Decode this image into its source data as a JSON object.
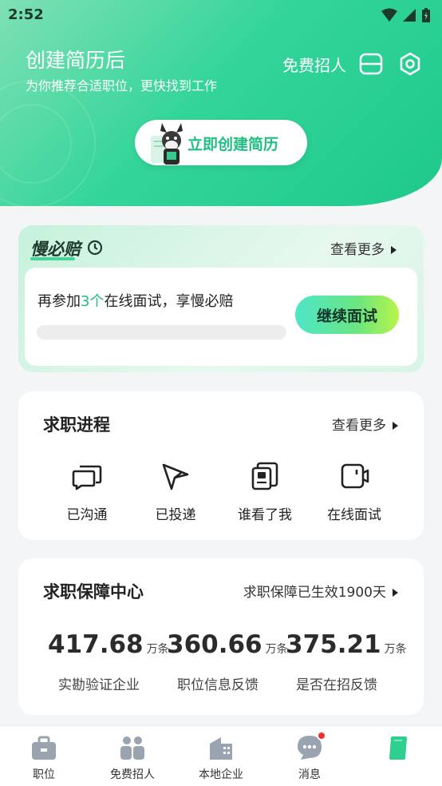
{
  "status_bar": {
    "time": "2:52"
  },
  "header": {
    "title": "创建简历后",
    "subtitle": "为你推荐合适职位，更快找到工作",
    "recruit_label": "免费招人",
    "create_resume_label": "立即创建简历"
  },
  "slow_comp": {
    "logo": "慢必赔",
    "more_label": "查看更多",
    "text_before": "再参加",
    "count": "3个",
    "text_after": "在线面试，享慢必赔",
    "progress": 0,
    "continue_label": "继续面试"
  },
  "job_progress": {
    "title": "求职进程",
    "more_label": "查看更多",
    "items": [
      {
        "label": "已沟通",
        "icon": "chat-icon"
      },
      {
        "label": "已投递",
        "icon": "send-icon"
      },
      {
        "label": "谁看了我",
        "icon": "resume-view-icon"
      },
      {
        "label": "在线面试",
        "icon": "video-icon"
      }
    ]
  },
  "guarantee": {
    "title": "求职保障中心",
    "status": "求职保障已生效1900天",
    "stats": [
      {
        "value": "417.68",
        "unit": "万条",
        "label": "实勘验证企业"
      },
      {
        "value": "360.66",
        "unit": "万条",
        "label": "职位信息反馈"
      },
      {
        "value": "375.21",
        "unit": "万条",
        "label": "是否在招反馈"
      }
    ]
  },
  "bottom_nav": {
    "items": [
      {
        "label": "职位",
        "icon": "briefcase-icon"
      },
      {
        "label": "免费招人",
        "icon": "people-icon"
      },
      {
        "label": "本地企业",
        "icon": "building-icon"
      },
      {
        "label": "消息",
        "icon": "message-icon"
      },
      {
        "label": "",
        "icon": "profile-icon"
      }
    ]
  },
  "colors": {
    "brand_green": "#1ec98a",
    "accent_green": "#22c07f",
    "badge_red": "#f23030"
  }
}
